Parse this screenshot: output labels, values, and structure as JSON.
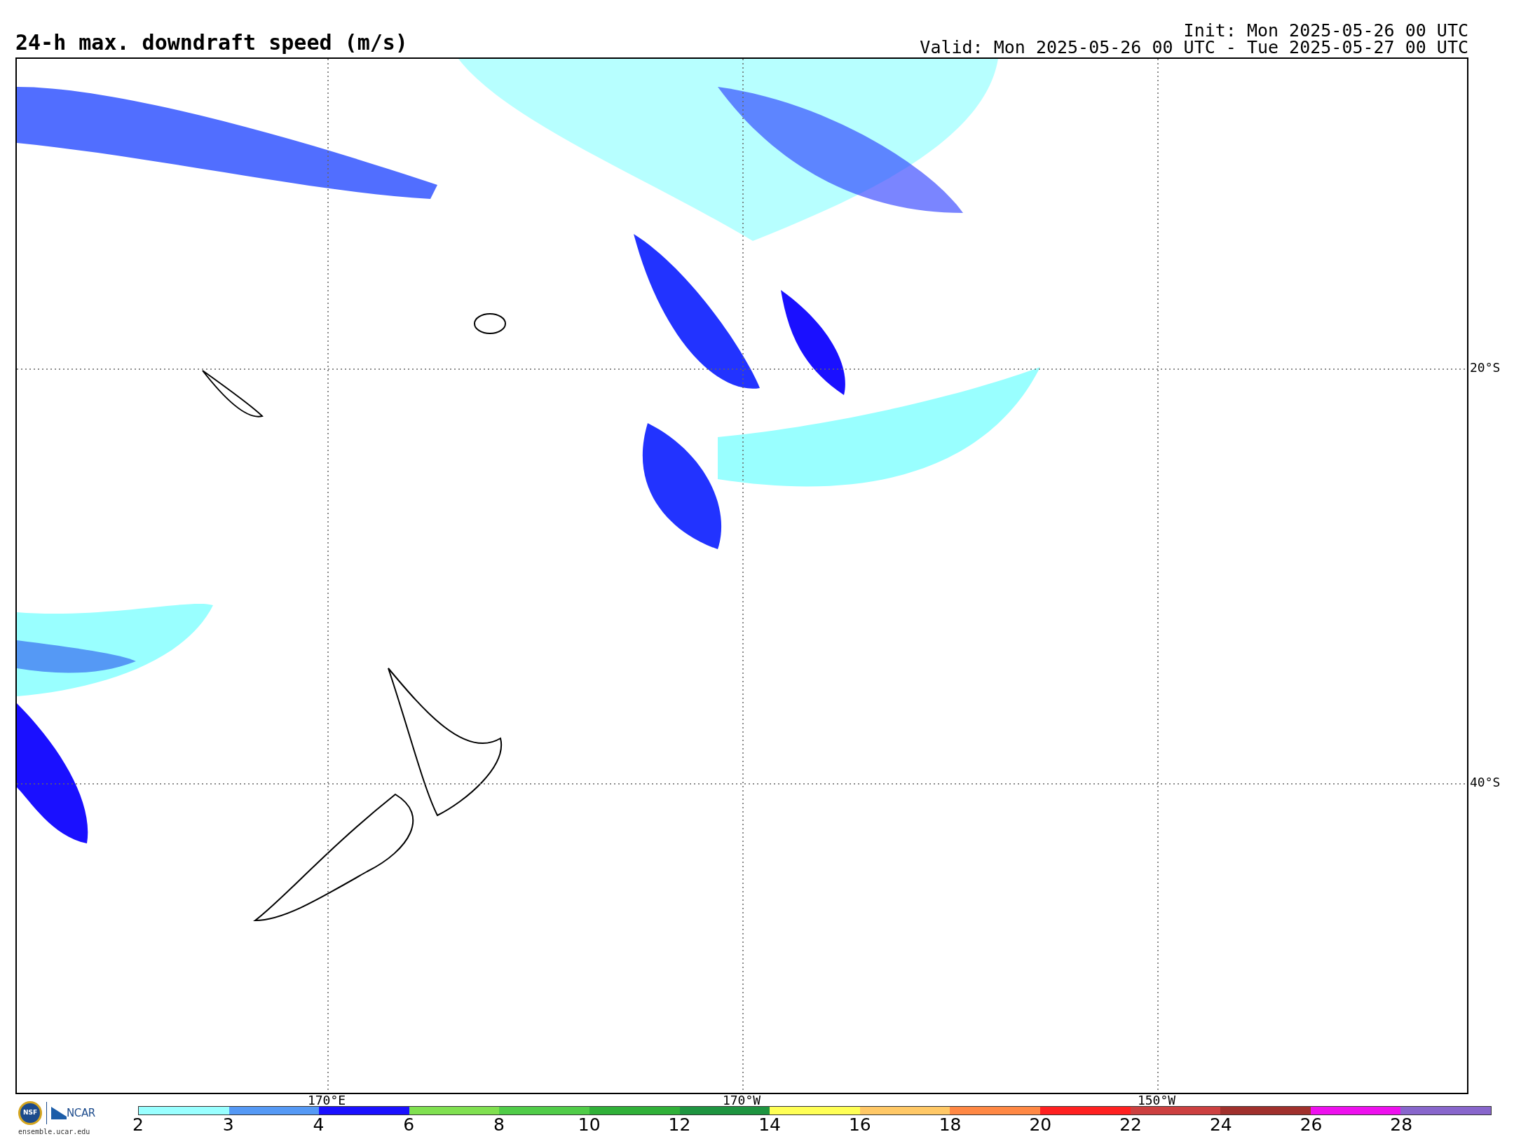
{
  "title": "24-h max. downdraft speed (m/s)",
  "init": "Init: Mon 2025-05-26 00 UTC",
  "valid": "Valid: Mon 2025-05-26 00 UTC - Tue 2025-05-27 00 UTC",
  "map": {
    "latitude_labels": [
      "20°S",
      "40°S"
    ],
    "longitude_labels": [
      "170°E",
      "170°W",
      "150°W"
    ]
  },
  "logo": {
    "nsf": "NSF",
    "org": "NCAR",
    "url": "ensemble.ucar.edu"
  },
  "colorbar": {
    "bins": [
      {
        "color": "#99ffff"
      },
      {
        "color": "#5599f5"
      },
      {
        "color": "#1a10ff"
      },
      {
        "color": "#80e050"
      },
      {
        "color": "#50cc48"
      },
      {
        "color": "#30b038"
      },
      {
        "color": "#1e9440"
      },
      {
        "color": "#ffff55"
      },
      {
        "color": "#ffc866"
      },
      {
        "color": "#ff8844"
      },
      {
        "color": "#ff2020"
      },
      {
        "color": "#cc4040"
      },
      {
        "color": "#a0302c"
      },
      {
        "color": "#ee10ee"
      },
      {
        "color": "#8866cc"
      }
    ],
    "tick_labels": [
      "2",
      "3",
      "4",
      "6",
      "8",
      "10",
      "12",
      "14",
      "16",
      "18",
      "20",
      "22",
      "24",
      "26",
      "28"
    ]
  }
}
